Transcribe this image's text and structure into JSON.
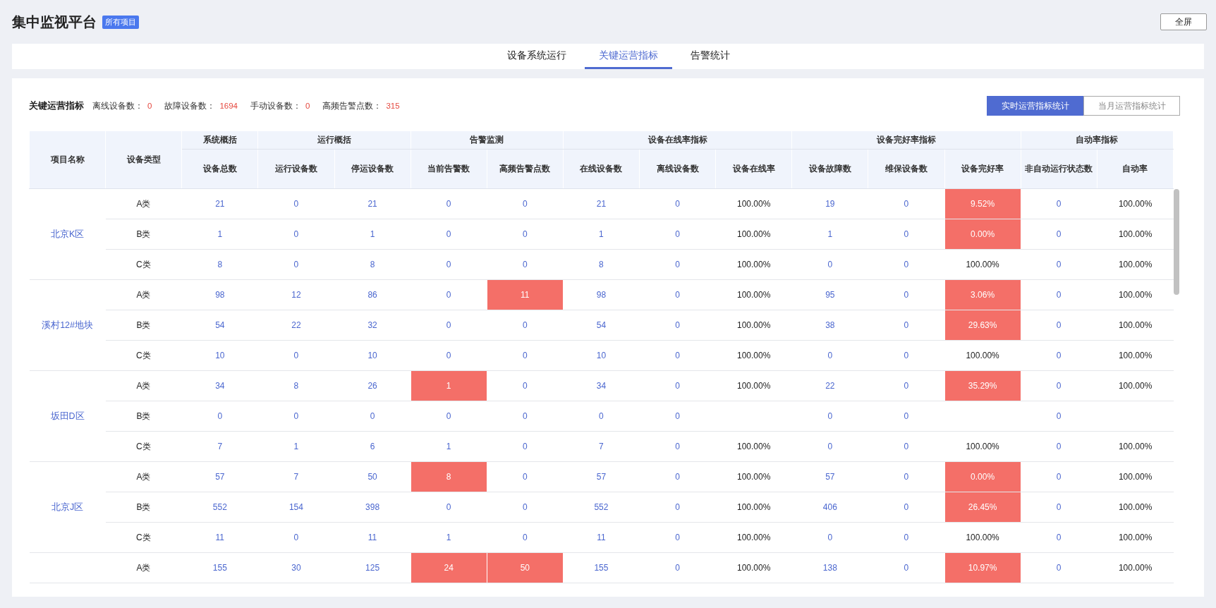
{
  "header": {
    "title": "集中监视平台",
    "badge": "所有项目",
    "fullscreen_button": "全屏"
  },
  "tabs": [
    {
      "label": "设备系统运行",
      "selected": false
    },
    {
      "label": "关键运营指标",
      "selected": true
    },
    {
      "label": "告警统计",
      "selected": false
    }
  ],
  "summary": {
    "title": "关键运营指标",
    "stats": [
      {
        "label": "离线设备数：",
        "value": "0"
      },
      {
        "label": "故障设备数：",
        "value": "1694"
      },
      {
        "label": "手动设备数：",
        "value": "0"
      },
      {
        "label": "高频告警点数：",
        "value": "315"
      }
    ]
  },
  "view_switch": [
    {
      "label": "实时运营指标统计",
      "selected": true
    },
    {
      "label": "当月运营指标统计",
      "selected": false
    }
  ],
  "table": {
    "fixed_columns": [
      "项目名称",
      "设备类型"
    ],
    "column_groups": [
      {
        "label": "系统概括",
        "columns": [
          {
            "label": "设备总数",
            "kind": "count"
          }
        ]
      },
      {
        "label": "运行概括",
        "columns": [
          {
            "label": "运行设备数",
            "kind": "count"
          },
          {
            "label": "停运设备数",
            "kind": "count"
          }
        ]
      },
      {
        "label": "告警监测",
        "columns": [
          {
            "label": "当前告警数",
            "kind": "count"
          },
          {
            "label": "高频告警点数",
            "kind": "count"
          }
        ]
      },
      {
        "label": "设备在线率指标",
        "columns": [
          {
            "label": "在线设备数",
            "kind": "count"
          },
          {
            "label": "离线设备数",
            "kind": "count"
          },
          {
            "label": "设备在线率",
            "kind": "rate"
          }
        ]
      },
      {
        "label": "设备完好率指标",
        "columns": [
          {
            "label": "设备故障数",
            "kind": "count"
          },
          {
            "label": "维保设备数",
            "kind": "count"
          },
          {
            "label": "设备完好率",
            "kind": "rate"
          }
        ]
      },
      {
        "label": "自动率指标",
        "columns": [
          {
            "label": "非自动运行状态数",
            "kind": "count"
          },
          {
            "label": "自动率",
            "kind": "rate"
          }
        ]
      }
    ],
    "groups": [
      {
        "name": "北京K区",
        "rows": [
          {
            "type": "A类",
            "cells": [
              {
                "text": "21",
                "alert": false
              },
              {
                "text": "0",
                "alert": false
              },
              {
                "text": "21",
                "alert": false
              },
              {
                "text": "0",
                "alert": false
              },
              {
                "text": "0",
                "alert": false
              },
              {
                "text": "21",
                "alert": false
              },
              {
                "text": "0",
                "alert": false
              },
              {
                "text": "100.00%",
                "alert": false
              },
              {
                "text": "19",
                "alert": false
              },
              {
                "text": "0",
                "alert": false
              },
              {
                "text": "9.52%",
                "alert": true
              },
              {
                "text": "0",
                "alert": false
              },
              {
                "text": "100.00%",
                "alert": false
              }
            ]
          },
          {
            "type": "B类",
            "cells": [
              {
                "text": "1",
                "alert": false
              },
              {
                "text": "0",
                "alert": false
              },
              {
                "text": "1",
                "alert": false
              },
              {
                "text": "0",
                "alert": false
              },
              {
                "text": "0",
                "alert": false
              },
              {
                "text": "1",
                "alert": false
              },
              {
                "text": "0",
                "alert": false
              },
              {
                "text": "100.00%",
                "alert": false
              },
              {
                "text": "1",
                "alert": false
              },
              {
                "text": "0",
                "alert": false
              },
              {
                "text": "0.00%",
                "alert": true
              },
              {
                "text": "0",
                "alert": false
              },
              {
                "text": "100.00%",
                "alert": false
              }
            ]
          },
          {
            "type": "C类",
            "cells": [
              {
                "text": "8",
                "alert": false
              },
              {
                "text": "0",
                "alert": false
              },
              {
                "text": "8",
                "alert": false
              },
              {
                "text": "0",
                "alert": false
              },
              {
                "text": "0",
                "alert": false
              },
              {
                "text": "8",
                "alert": false
              },
              {
                "text": "0",
                "alert": false
              },
              {
                "text": "100.00%",
                "alert": false
              },
              {
                "text": "0",
                "alert": false
              },
              {
                "text": "0",
                "alert": false
              },
              {
                "text": "100.00%",
                "alert": false
              },
              {
                "text": "0",
                "alert": false
              },
              {
                "text": "100.00%",
                "alert": false
              }
            ]
          }
        ]
      },
      {
        "name": "溪村12#地块",
        "rows": [
          {
            "type": "A类",
            "cells": [
              {
                "text": "98",
                "alert": false
              },
              {
                "text": "12",
                "alert": false
              },
              {
                "text": "86",
                "alert": false
              },
              {
                "text": "0",
                "alert": false
              },
              {
                "text": "11",
                "alert": true
              },
              {
                "text": "98",
                "alert": false
              },
              {
                "text": "0",
                "alert": false
              },
              {
                "text": "100.00%",
                "alert": false
              },
              {
                "text": "95",
                "alert": false
              },
              {
                "text": "0",
                "alert": false
              },
              {
                "text": "3.06%",
                "alert": true
              },
              {
                "text": "0",
                "alert": false
              },
              {
                "text": "100.00%",
                "alert": false
              }
            ]
          },
          {
            "type": "B类",
            "cells": [
              {
                "text": "54",
                "alert": false
              },
              {
                "text": "22",
                "alert": false
              },
              {
                "text": "32",
                "alert": false
              },
              {
                "text": "0",
                "alert": false
              },
              {
                "text": "0",
                "alert": false
              },
              {
                "text": "54",
                "alert": false
              },
              {
                "text": "0",
                "alert": false
              },
              {
                "text": "100.00%",
                "alert": false
              },
              {
                "text": "38",
                "alert": false
              },
              {
                "text": "0",
                "alert": false
              },
              {
                "text": "29.63%",
                "alert": true
              },
              {
                "text": "0",
                "alert": false
              },
              {
                "text": "100.00%",
                "alert": false
              }
            ]
          },
          {
            "type": "C类",
            "cells": [
              {
                "text": "10",
                "alert": false
              },
              {
                "text": "0",
                "alert": false
              },
              {
                "text": "10",
                "alert": false
              },
              {
                "text": "0",
                "alert": false
              },
              {
                "text": "0",
                "alert": false
              },
              {
                "text": "10",
                "alert": false
              },
              {
                "text": "0",
                "alert": false
              },
              {
                "text": "100.00%",
                "alert": false
              },
              {
                "text": "0",
                "alert": false
              },
              {
                "text": "0",
                "alert": false
              },
              {
                "text": "100.00%",
                "alert": false
              },
              {
                "text": "0",
                "alert": false
              },
              {
                "text": "100.00%",
                "alert": false
              }
            ]
          }
        ]
      },
      {
        "name": "坂田D区",
        "rows": [
          {
            "type": "A类",
            "cells": [
              {
                "text": "34",
                "alert": false
              },
              {
                "text": "8",
                "alert": false
              },
              {
                "text": "26",
                "alert": false
              },
              {
                "text": "1",
                "alert": true
              },
              {
                "text": "0",
                "alert": false
              },
              {
                "text": "34",
                "alert": false
              },
              {
                "text": "0",
                "alert": false
              },
              {
                "text": "100.00%",
                "alert": false
              },
              {
                "text": "22",
                "alert": false
              },
              {
                "text": "0",
                "alert": false
              },
              {
                "text": "35.29%",
                "alert": true
              },
              {
                "text": "0",
                "alert": false
              },
              {
                "text": "100.00%",
                "alert": false
              }
            ]
          },
          {
            "type": "B类",
            "cells": [
              {
                "text": "0",
                "alert": false
              },
              {
                "text": "0",
                "alert": false
              },
              {
                "text": "0",
                "alert": false
              },
              {
                "text": "0",
                "alert": false
              },
              {
                "text": "0",
                "alert": false
              },
              {
                "text": "0",
                "alert": false
              },
              {
                "text": "0",
                "alert": false
              },
              {
                "alert": false
              },
              {
                "text": "0",
                "alert": false
              },
              {
                "text": "0",
                "alert": false
              },
              {
                "alert": false
              },
              {
                "text": "0",
                "alert": false
              },
              {
                "alert": false
              }
            ]
          },
          {
            "type": "C类",
            "cells": [
              {
                "text": "7",
                "alert": false
              },
              {
                "text": "1",
                "alert": false
              },
              {
                "text": "6",
                "alert": false
              },
              {
                "text": "1",
                "alert": false
              },
              {
                "text": "0",
                "alert": false
              },
              {
                "text": "7",
                "alert": false
              },
              {
                "text": "0",
                "alert": false
              },
              {
                "text": "100.00%",
                "alert": false
              },
              {
                "text": "0",
                "alert": false
              },
              {
                "text": "0",
                "alert": false
              },
              {
                "text": "100.00%",
                "alert": false
              },
              {
                "text": "0",
                "alert": false
              },
              {
                "text": "100.00%",
                "alert": false
              }
            ]
          }
        ]
      },
      {
        "name": "北京J区",
        "rows": [
          {
            "type": "A类",
            "cells": [
              {
                "text": "57",
                "alert": false
              },
              {
                "text": "7",
                "alert": false
              },
              {
                "text": "50",
                "alert": false
              },
              {
                "text": "8",
                "alert": true
              },
              {
                "text": "0",
                "alert": false
              },
              {
                "text": "57",
                "alert": false
              },
              {
                "text": "0",
                "alert": false
              },
              {
                "text": "100.00%",
                "alert": false
              },
              {
                "text": "57",
                "alert": false
              },
              {
                "text": "0",
                "alert": false
              },
              {
                "text": "0.00%",
                "alert": true
              },
              {
                "text": "0",
                "alert": false
              },
              {
                "text": "100.00%",
                "alert": false
              }
            ]
          },
          {
            "type": "B类",
            "cells": [
              {
                "text": "552",
                "alert": false
              },
              {
                "text": "154",
                "alert": false
              },
              {
                "text": "398",
                "alert": false
              },
              {
                "text": "0",
                "alert": false
              },
              {
                "text": "0",
                "alert": false
              },
              {
                "text": "552",
                "alert": false
              },
              {
                "text": "0",
                "alert": false
              },
              {
                "text": "100.00%",
                "alert": false
              },
              {
                "text": "406",
                "alert": false
              },
              {
                "text": "0",
                "alert": false
              },
              {
                "text": "26.45%",
                "alert": true
              },
              {
                "text": "0",
                "alert": false
              },
              {
                "text": "100.00%",
                "alert": false
              }
            ]
          },
          {
            "type": "C类",
            "cells": [
              {
                "text": "11",
                "alert": false
              },
              {
                "text": "0",
                "alert": false
              },
              {
                "text": "11",
                "alert": false
              },
              {
                "text": "1",
                "alert": false
              },
              {
                "text": "0",
                "alert": false
              },
              {
                "text": "11",
                "alert": false
              },
              {
                "text": "0",
                "alert": false
              },
              {
                "text": "100.00%",
                "alert": false
              },
              {
                "text": "0",
                "alert": false
              },
              {
                "text": "0",
                "alert": false
              },
              {
                "text": "100.00%",
                "alert": false
              },
              {
                "text": "0",
                "alert": false
              },
              {
                "text": "100.00%",
                "alert": false
              }
            ]
          }
        ]
      },
      {
        "rows": [
          {
            "type": "A类",
            "cells": [
              {
                "text": "155",
                "alert": false
              },
              {
                "text": "30",
                "alert": false
              },
              {
                "text": "125",
                "alert": false
              },
              {
                "text": "24",
                "alert": true
              },
              {
                "text": "50",
                "alert": true
              },
              {
                "text": "155",
                "alert": false
              },
              {
                "text": "0",
                "alert": false
              },
              {
                "text": "100.00%",
                "alert": false
              },
              {
                "text": "138",
                "alert": false
              },
              {
                "text": "0",
                "alert": false
              },
              {
                "text": "10.97%",
                "alert": true
              },
              {
                "text": "0",
                "alert": false
              },
              {
                "text": "100.00%",
                "alert": false
              }
            ]
          }
        ]
      }
    ]
  }
}
